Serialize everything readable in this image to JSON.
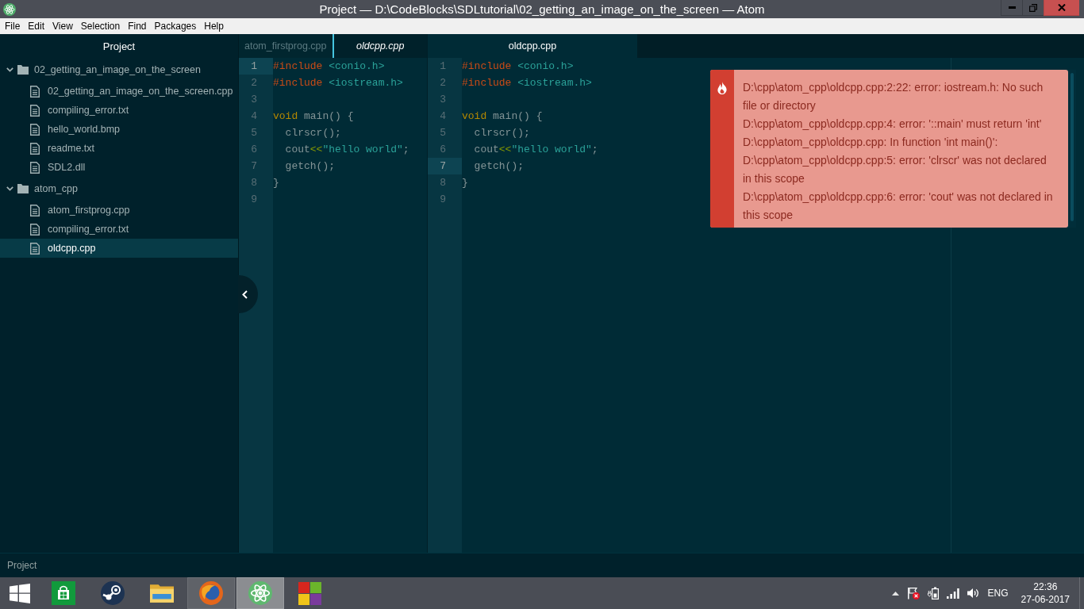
{
  "window": {
    "title": "Project — D:\\CodeBlocks\\SDLtutorial\\02_getting_an_image_on_the_screen — Atom"
  },
  "menu_bar": [
    "File",
    "Edit",
    "View",
    "Selection",
    "Find",
    "Packages",
    "Help"
  ],
  "tree_view": {
    "title": "Project",
    "items": [
      {
        "kind": "folder",
        "label": "02_getting_an_image_on_the_screen",
        "expanded": true,
        "selected": false,
        "children": [
          {
            "kind": "file",
            "label": "02_getting_an_image_on_the_screen.cpp",
            "selected": false
          },
          {
            "kind": "file",
            "label": "compiling_error.txt",
            "selected": false
          },
          {
            "kind": "file",
            "label": "hello_world.bmp",
            "selected": false
          },
          {
            "kind": "file",
            "label": "readme.txt",
            "selected": false
          },
          {
            "kind": "file",
            "label": "SDL2.dll",
            "selected": false
          }
        ]
      },
      {
        "kind": "folder",
        "label": "atom_cpp",
        "expanded": true,
        "selected": false,
        "children": [
          {
            "kind": "file",
            "label": "atom_firstprog.cpp",
            "selected": false
          },
          {
            "kind": "file",
            "label": "compiling_error.txt",
            "selected": false
          },
          {
            "kind": "file",
            "label": "oldcpp.cpp",
            "selected": true
          }
        ]
      }
    ]
  },
  "panes": [
    {
      "focused": false,
      "tabs": [
        {
          "label": "atom_firstprog.cpp",
          "selected": false,
          "pending": false
        },
        {
          "label": "oldcpp.cpp",
          "selected": true,
          "pending": true
        }
      ],
      "lines": [
        {
          "number": "1",
          "selected": true,
          "tokens": [
            {
              "kind": "directive",
              "text": "#include "
            },
            {
              "kind": "header",
              "text": "<conio.h>"
            }
          ]
        },
        {
          "number": "2",
          "selected": false,
          "tokens": [
            {
              "kind": "directive",
              "text": "#include "
            },
            {
              "kind": "header",
              "text": "<iostream.h>"
            }
          ]
        },
        {
          "number": "3",
          "selected": false
        },
        {
          "number": "4",
          "selected": false,
          "tokens": [
            {
              "kind": "type",
              "text": "void"
            },
            {
              "kind": "plain",
              "text": " main() {"
            }
          ]
        },
        {
          "number": "5",
          "selected": false,
          "tokens": [
            {
              "kind": "plain",
              "text": "  clrscr();"
            }
          ]
        },
        {
          "number": "6",
          "selected": false,
          "tokens": [
            {
              "kind": "plain",
              "text": "  cout"
            },
            {
              "kind": "operator",
              "text": "<<"
            },
            {
              "kind": "string",
              "text": "\"hello world\""
            },
            {
              "kind": "plain",
              "text": ";"
            }
          ]
        },
        {
          "number": "7",
          "selected": false,
          "tokens": [
            {
              "kind": "plain",
              "text": "  getch();"
            }
          ]
        },
        {
          "number": "8",
          "selected": false,
          "tokens": [
            {
              "kind": "plain",
              "text": "}"
            }
          ]
        },
        {
          "number": "9",
          "selected": false
        }
      ]
    },
    {
      "focused": true,
      "tabs": [
        {
          "label": "oldcpp.cpp",
          "selected": true,
          "pending": false
        }
      ],
      "lines": [
        {
          "number": "1",
          "selected": false,
          "tokens": [
            {
              "kind": "directive",
              "text": "#include "
            },
            {
              "kind": "header",
              "text": "<conio.h>"
            }
          ]
        },
        {
          "number": "2",
          "selected": false,
          "tokens": [
            {
              "kind": "directive",
              "text": "#include "
            },
            {
              "kind": "header",
              "text": "<iostream.h>"
            }
          ]
        },
        {
          "number": "3",
          "selected": false
        },
        {
          "number": "4",
          "selected": false,
          "tokens": [
            {
              "kind": "type",
              "text": "void"
            },
            {
              "kind": "plain",
              "text": " main() {"
            }
          ]
        },
        {
          "number": "5",
          "selected": false,
          "tokens": [
            {
              "kind": "plain",
              "text": "  clrscr();"
            }
          ]
        },
        {
          "number": "6",
          "selected": false,
          "tokens": [
            {
              "kind": "plain",
              "text": "  cout"
            },
            {
              "kind": "operator",
              "text": "<<"
            },
            {
              "kind": "string",
              "text": "\"hello world\""
            },
            {
              "kind": "plain",
              "text": ";"
            }
          ]
        },
        {
          "number": "7",
          "selected": true,
          "tokens": [
            {
              "kind": "plain",
              "text": "  getch();"
            }
          ]
        },
        {
          "number": "8",
          "selected": false,
          "tokens": [
            {
              "kind": "plain",
              "text": "}"
            }
          ]
        },
        {
          "number": "9",
          "selected": false
        }
      ]
    }
  ],
  "notification": {
    "kind": "error",
    "messages": [
      "D:\\cpp\\atom_cpp\\oldcpp.cpp:2:22: error: iostream.h: No such file or directory",
      "D:\\cpp\\atom_cpp\\oldcpp.cpp:4: error: '::main' must return 'int'",
      "D:\\cpp\\atom_cpp\\oldcpp.cpp: In function 'int main()':",
      "D:\\cpp\\atom_cpp\\oldcpp.cpp:5: error: 'clrscr' was not declared in this scope",
      "D:\\cpp\\atom_cpp\\oldcpp.cpp:6: error: 'cout' was not declared in this scope"
    ]
  },
  "status_bar": {
    "text": "Project"
  },
  "taskbar": {
    "apps": [
      {
        "open": false,
        "selected": false
      },
      {
        "open": false,
        "selected": false
      },
      {
        "open": false,
        "selected": false
      },
      {
        "open": true,
        "selected": false
      },
      {
        "open": true,
        "selected": true
      },
      {
        "open": false,
        "selected": false
      }
    ],
    "tray": {
      "language": "ENG",
      "time": "22:36",
      "date": "27-06-2017"
    }
  }
}
